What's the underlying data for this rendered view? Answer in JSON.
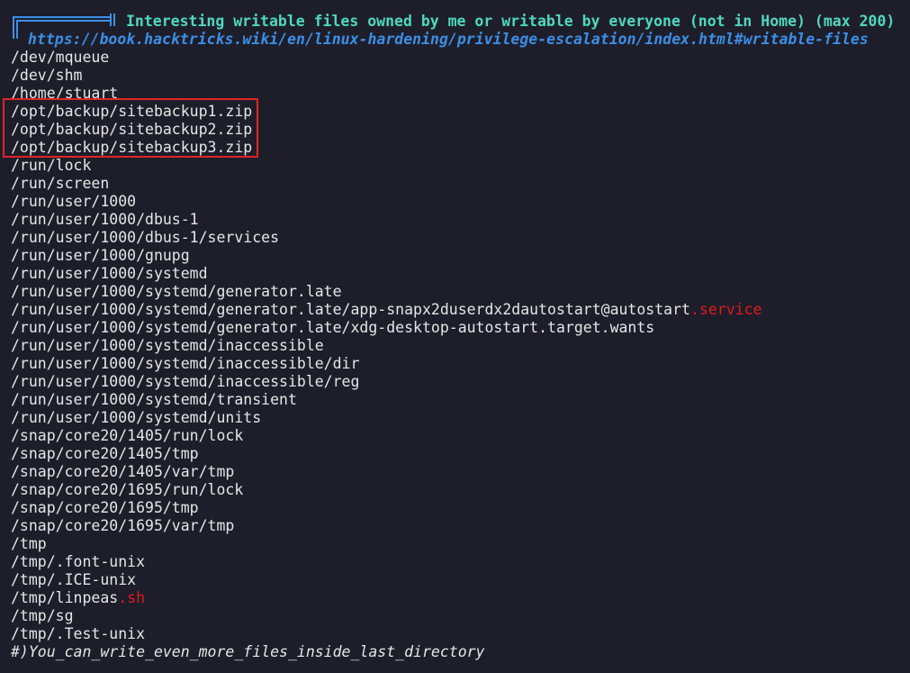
{
  "header": {
    "box_icon": "box-drawing-corner-icon",
    "title": "Interesting writable files owned by me or writable by everyone (not in Home) (max 200)",
    "link": "https://book.hacktricks.wiki/en/linux-hardening/privilege-escalation/index.html#writable-files"
  },
  "colors": {
    "background": "#1e1e2a",
    "text": "#e6e6e6",
    "title": "#4dd9c0",
    "link": "#3b8fe6",
    "highlight_red": "#e01b1b",
    "annotation_box": "#e02424"
  },
  "lines": [
    {
      "text": "/dev/mqueue",
      "suffix": ""
    },
    {
      "text": "/dev/shm",
      "suffix": ""
    },
    {
      "text": "/home/stuart",
      "suffix": ""
    },
    {
      "text": "/opt/backup/sitebackup1.zip",
      "suffix": ""
    },
    {
      "text": "/opt/backup/sitebackup2.zip",
      "suffix": ""
    },
    {
      "text": "/opt/backup/sitebackup3.zip",
      "suffix": ""
    },
    {
      "text": "/run/lock",
      "suffix": ""
    },
    {
      "text": "/run/screen",
      "suffix": ""
    },
    {
      "text": "/run/user/1000",
      "suffix": ""
    },
    {
      "text": "/run/user/1000/dbus-1",
      "suffix": ""
    },
    {
      "text": "/run/user/1000/dbus-1/services",
      "suffix": ""
    },
    {
      "text": "/run/user/1000/gnupg",
      "suffix": ""
    },
    {
      "text": "/run/user/1000/systemd",
      "suffix": ""
    },
    {
      "text": "/run/user/1000/systemd/generator.late",
      "suffix": ""
    },
    {
      "text": "/run/user/1000/systemd/generator.late/app-snapx2duserdx2dautostart@autostart",
      "suffix": ".service"
    },
    {
      "text": "/run/user/1000/systemd/generator.late/xdg-desktop-autostart.target.wants",
      "suffix": ""
    },
    {
      "text": "/run/user/1000/systemd/inaccessible",
      "suffix": ""
    },
    {
      "text": "/run/user/1000/systemd/inaccessible/dir",
      "suffix": ""
    },
    {
      "text": "/run/user/1000/systemd/inaccessible/reg",
      "suffix": ""
    },
    {
      "text": "/run/user/1000/systemd/transient",
      "suffix": ""
    },
    {
      "text": "/run/user/1000/systemd/units",
      "suffix": ""
    },
    {
      "text": "/snap/core20/1405/run/lock",
      "suffix": ""
    },
    {
      "text": "/snap/core20/1405/tmp",
      "suffix": ""
    },
    {
      "text": "/snap/core20/1405/var/tmp",
      "suffix": ""
    },
    {
      "text": "/snap/core20/1695/run/lock",
      "suffix": ""
    },
    {
      "text": "/snap/core20/1695/tmp",
      "suffix": ""
    },
    {
      "text": "/snap/core20/1695/var/tmp",
      "suffix": ""
    },
    {
      "text": "/tmp",
      "suffix": ""
    },
    {
      "text": "/tmp/.font-unix",
      "suffix": ""
    },
    {
      "text": "/tmp/.ICE-unix",
      "suffix": ""
    },
    {
      "text": "/tmp/linpeas",
      "suffix": ".sh"
    },
    {
      "text": "/tmp/sg",
      "suffix": ""
    },
    {
      "text": "/tmp/.Test-unix",
      "suffix": ""
    }
  ],
  "footer": {
    "comment": "#)You_can_write_even_more_files_inside_last_directory"
  }
}
